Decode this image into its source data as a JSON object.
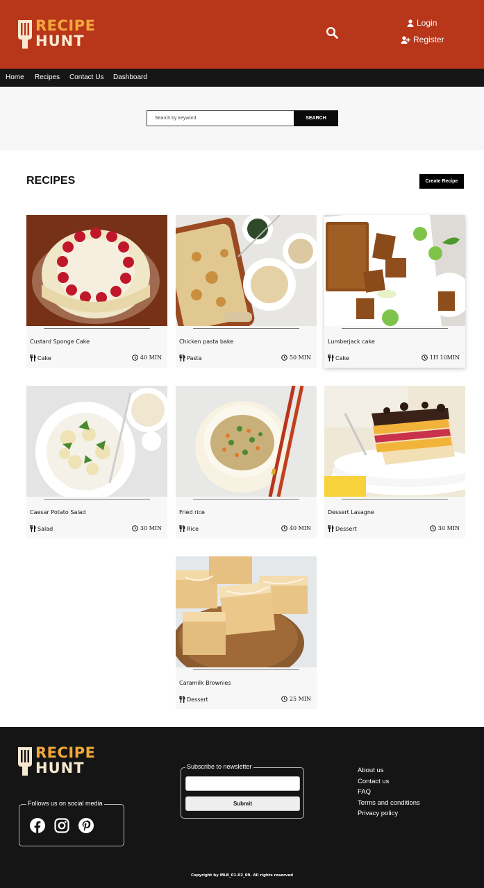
{
  "brand": {
    "word1": "RECIPE",
    "word2": "HUNT"
  },
  "header": {
    "login": "Login",
    "register": "Register"
  },
  "nav": [
    "Home",
    "Recipes",
    "Contact Us",
    "Dashboard"
  ],
  "search": {
    "placeholder": "Search by keyword",
    "button": "SEARCH"
  },
  "recipes": {
    "title": "RECIPES",
    "create_button": "Create Recipe",
    "items": [
      {
        "name": "Custard Sponge Cake",
        "category": "Cake",
        "time": "40 MIN"
      },
      {
        "name": "Chicken pasta bake",
        "category": "Pasta",
        "time": "50 MIN"
      },
      {
        "name": "Lumberjack cake",
        "category": "Cake",
        "time": "1H 10MIN"
      },
      {
        "name": "Caesar Potato Salad",
        "category": "Salad",
        "time": "30 MIN"
      },
      {
        "name": "Fried rice",
        "category": "Rice",
        "time": "40 MIN"
      },
      {
        "name": "Dessert Lasagne",
        "category": "Dessert",
        "time": "30 MIN"
      },
      {
        "name": "Caramilk Brownies",
        "category": "Dessert",
        "time": "25 MIN"
      }
    ]
  },
  "footer": {
    "social_legend": "Follows us on social media",
    "social_icons": [
      "facebook-icon",
      "instagram-icon",
      "pinterest-icon"
    ],
    "newsletter_legend": "Subscribe to newsletter",
    "newsletter_button": "Submit",
    "links": [
      "About us",
      "Contact us",
      "FAQ",
      "Terms and conditions",
      "Privacy policy"
    ],
    "copyright": "Copyright by MLB_01.02_09. All rights reserved"
  },
  "colors": {
    "header": "#b8361a",
    "nav": "#161616",
    "footer": "#151515",
    "brand_orange": "#f2a93b",
    "brand_cream": "#f6e9d0"
  }
}
